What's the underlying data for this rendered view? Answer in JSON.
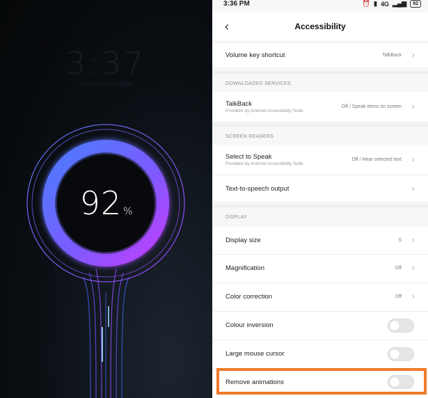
{
  "charging": {
    "faint_clock": "3:37",
    "faint_date": "Saturday, 3 August",
    "percent": "92",
    "percent_sign": "%",
    "colors": {
      "ring_blue": "#4f79ff",
      "ring_purple": "#b13cff",
      "background": "#07090c"
    }
  },
  "statusbar": {
    "time": "3:36 PM",
    "network": "4G",
    "battery": "92"
  },
  "header": {
    "back_icon": "chevron-left-icon",
    "title": "Accessibility"
  },
  "rows": {
    "volume_key": {
      "label": "Volume key shortcut",
      "value": "TalkBack"
    },
    "talkback": {
      "label": "TalkBack",
      "sub": "Provided by Android Accessibility Suite",
      "value": "Off / Speak items on screen"
    },
    "select_to_speak": {
      "label": "Select to Speak",
      "sub": "Provided by Android Accessibility Suite",
      "value": "Off / Hear selected text"
    },
    "tts": {
      "label": "Text-to-speech output"
    },
    "display_size": {
      "label": "Display size",
      "value": "S"
    },
    "magnification": {
      "label": "Magnification",
      "value": "Off"
    },
    "color_correction": {
      "label": "Color correction",
      "value": "Off"
    },
    "colour_inversion": {
      "label": "Colour inversion",
      "toggle": false
    },
    "large_cursor": {
      "label": "Large mouse cursor",
      "toggle": false
    },
    "remove_animations": {
      "label": "Remove animations",
      "toggle": false
    }
  },
  "sections": {
    "downloaded": "DOWNLOADED SERVICES",
    "screen_readers": "SCREEN READERS",
    "display": "DISPLAY"
  },
  "highlight_color": "#ef7a2b"
}
